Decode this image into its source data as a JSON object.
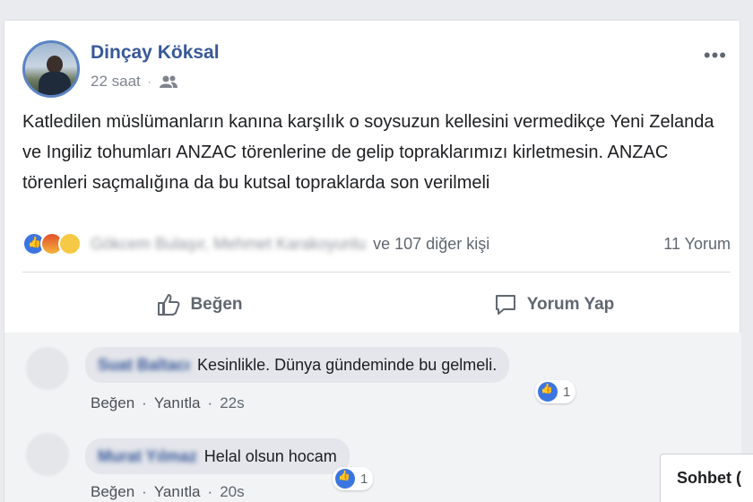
{
  "post": {
    "author": "Dinçay Köksal",
    "time": "22 saat",
    "separator": "·",
    "text": "Katledilen müslümanların kanına karşılık o soysuzun kellesini vermedikçe Yeni Zelanda ve Ingiliz tohumları ANZAC törenlerine de gelip topraklarımızı kirletmesin. ANZAC törenleri saçmalığına da bu kutsal topraklarda son verilmeli",
    "reaction_names": "Gökcem Bulaşır, Mehmet Karakoyunlu",
    "reaction_others": "ve 107 diğer kişi",
    "comment_count": "11 Yorum"
  },
  "actions": {
    "like": "Beğen",
    "comment": "Yorum Yap"
  },
  "comments": [
    {
      "name": "Suat Baltacı",
      "text": "Kesinlikle. Dünya gündeminde bu gelmeli.",
      "like": "Beğen",
      "reply": "Yanıtla",
      "time": "22s",
      "reactions": "1"
    },
    {
      "name": "Murat Yılmaz",
      "text": "Helal olsun hocam",
      "like": "Beğen",
      "reply": "Yanıtla",
      "time": "20s",
      "reactions": "1"
    }
  ],
  "chat": {
    "label": "Sohbet ("
  },
  "colors": {
    "link": "#385898",
    "background": "#e9ebee",
    "like_blue": "#3b76e0"
  }
}
